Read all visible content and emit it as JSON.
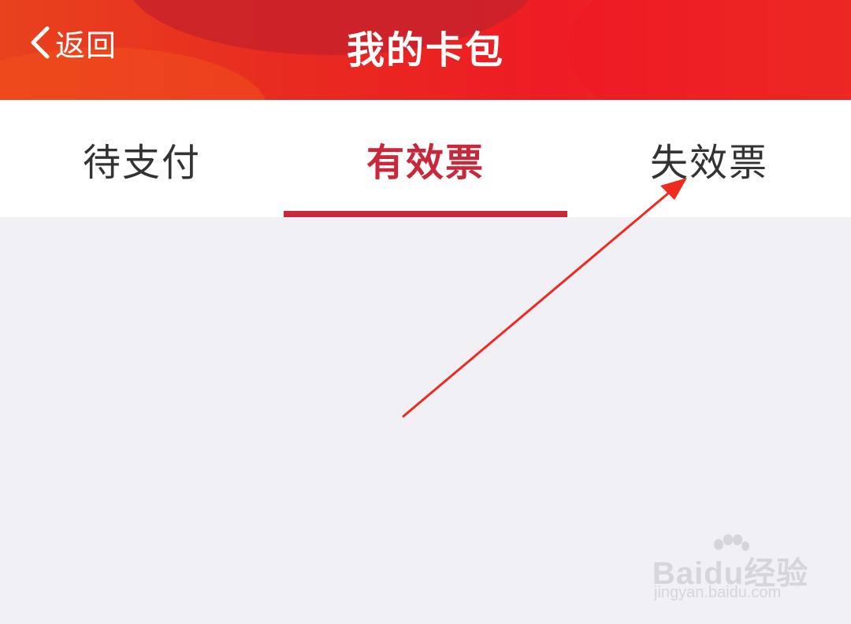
{
  "header": {
    "back_label": "返回",
    "title": "我的卡包",
    "back_icon": "chevron-left-icon"
  },
  "tabs": [
    {
      "label": "待支付",
      "active": false
    },
    {
      "label": "有效票",
      "active": true
    },
    {
      "label": "失效票",
      "active": false
    }
  ],
  "colors": {
    "header_red": "#ee1c24",
    "active_tab": "#c8283a",
    "tab_text": "#333333",
    "content_bg": "#f1f0f5",
    "annotation_arrow": "#ee2b1e"
  },
  "annotation": {
    "type": "arrow",
    "points_to": "tab-expired-tickets"
  },
  "watermark": {
    "brand": "Baidu经验",
    "url": "jingyan.baidu.com"
  }
}
